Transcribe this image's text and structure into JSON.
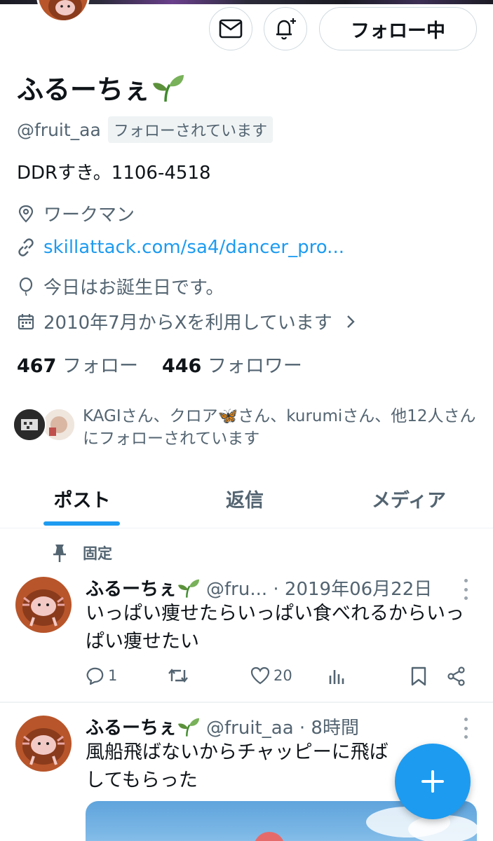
{
  "profile": {
    "display_name": "ふるーちぇ",
    "name_emoji": "seedling-icon",
    "handle": "@fruit_aa",
    "follows_you": "フォローされています",
    "bio": "DDRすき。1106-4518",
    "location": "ワークマン",
    "website": "skillattack.com/sa4/dancer_pro...",
    "birthday": "今日はお誕生日です。",
    "joined": "2010年7月からXを利用しています"
  },
  "header_buttons": {
    "follow_label": "フォロー中",
    "message_icon": "envelope-icon",
    "notify_icon": "bell-plus-icon"
  },
  "counts": {
    "following_num": "467",
    "following_label": "フォロー",
    "followers_num": "446",
    "followers_label": "フォロワー"
  },
  "followed_by": {
    "text": "KAGIさん、クロア🦋さん、kurumiさん、他12人さんにフォローされています"
  },
  "tabs": [
    {
      "label": "ポスト",
      "active": true
    },
    {
      "label": "返信",
      "active": false
    },
    {
      "label": "メディア",
      "active": false
    }
  ],
  "pinned_label": "固定",
  "posts": [
    {
      "name": "ふるーちぇ",
      "meta": "@fru... · 2019年06月22日",
      "text": "いっぱい痩せたらいっぱい食べれるからいっぱい痩せたい",
      "replies": "1",
      "reposts": "",
      "likes": "20"
    },
    {
      "name": "ふるーちぇ",
      "meta": "@fruit_aa · 8時間",
      "text": "風船飛ばないからチャッピーに飛ばしてもらった"
    }
  ],
  "colors": {
    "accent": "#1d9bf0",
    "secondary_text": "#536471",
    "border": "#cfd9de"
  }
}
